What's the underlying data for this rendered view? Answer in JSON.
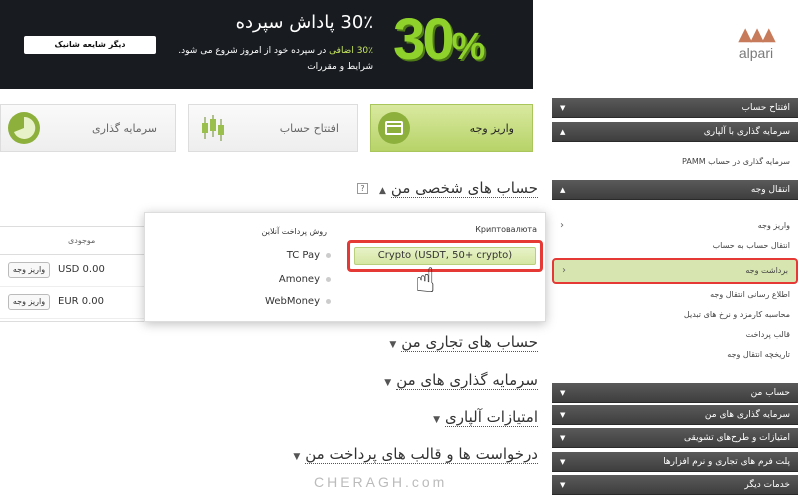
{
  "banner": {
    "percent": "30",
    "percent_sign": "%",
    "title": "30٪ پاداش سپرده",
    "line1_pre": "30٪ اضافی",
    "line1_post": "در سپرده خود از امروز شروع می شود.",
    "line2": "شرایط و مقررات",
    "button": "دیگر شایعه شانیک"
  },
  "logo": {
    "word": "alpari"
  },
  "tabs": [
    {
      "label": "واریز وجه"
    },
    {
      "label": "افتتاح حساب"
    },
    {
      "label": "سرمایه گذاری"
    }
  ],
  "sections": {
    "personal": "حساب های شخصی من",
    "trading": "حساب های تجاری من",
    "investments": "سرمایه گذاری های من",
    "privileges": "امتیازات آلپاری",
    "requests": "درخواست ها و قالب های پرداخت من"
  },
  "table": {
    "balance_header": "موجودی",
    "rows": [
      {
        "amount": "USD 0.00",
        "deposit": "واریز وجه"
      },
      {
        "amount": "EUR 0.00",
        "deposit": "واریز وجه"
      }
    ]
  },
  "popup": {
    "online_header": "روش پرداخت آنلاین",
    "crypto_header": "Криптовалюта",
    "options": [
      "TC Pay",
      "Amoney",
      "WebMoney"
    ],
    "crypto_option": "Crypto (USDT, 50+ crypto)"
  },
  "menu": {
    "items": [
      {
        "label": "افتتاح حساب",
        "tri": "▼"
      },
      {
        "label": "سرمایه گذاری با آلپاری",
        "tri": "▲"
      },
      {
        "label": "انتقال وجه",
        "tri": "▲"
      },
      {
        "label": "حساب من",
        "tri": "▼"
      },
      {
        "label": "سرمایه گذاری های من",
        "tri": "▼"
      },
      {
        "label": "امتیازات و طرح‌های تشویقی",
        "tri": "▼"
      },
      {
        "label": "پلت فرم های تجاری و نرم افزارها",
        "tri": "▼"
      },
      {
        "label": "خدمات دیگر",
        "tri": "▼"
      }
    ],
    "invest_sub": "سرمایه گذاری در حساب PAMM",
    "transfer_subs": [
      "واریز وجه",
      "انتقال حساب به حساب",
      "برداشت وجه",
      "اطلاع رسانی انتقال وجه",
      "محاسبه کارمزد و نرخ های تبدیل",
      "قالب پرداخت",
      "تاریخچه انتقال وجه"
    ]
  },
  "watermark": "CHERAGH.com"
}
